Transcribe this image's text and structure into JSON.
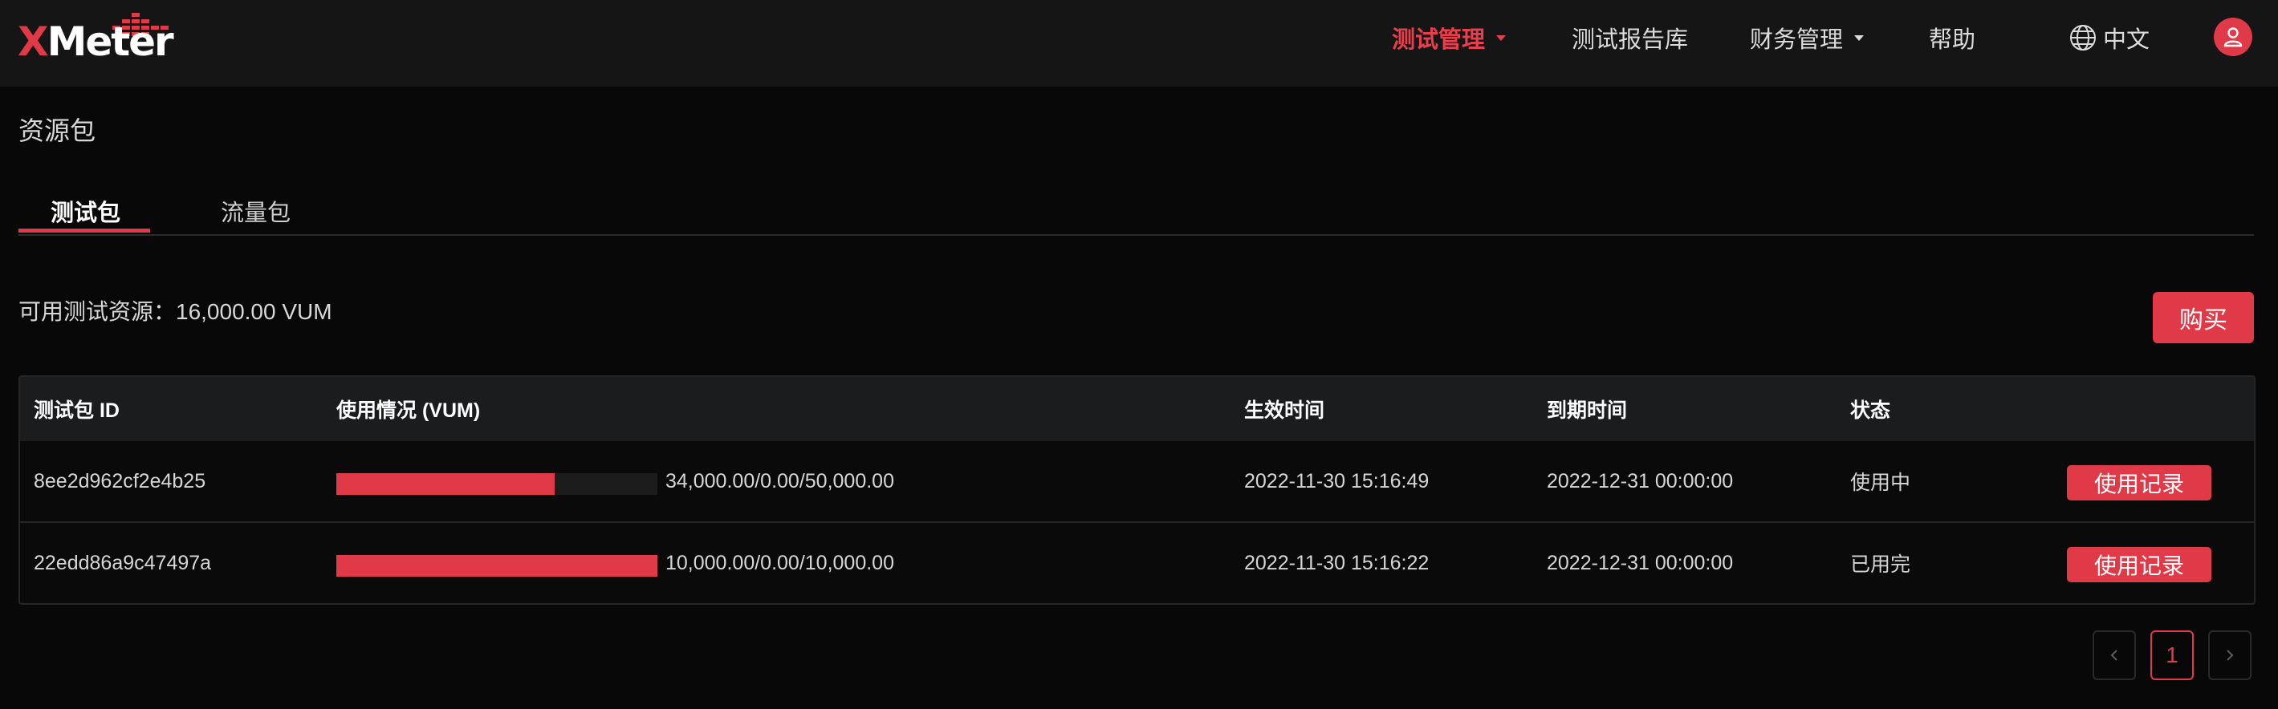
{
  "brand": {
    "logo_text": "XMeter",
    "accent": "#e03a48"
  },
  "nav": {
    "items": [
      {
        "label": "测试管理",
        "active": true,
        "dropdown": true
      },
      {
        "label": "测试报告库",
        "active": false,
        "dropdown": false
      },
      {
        "label": "财务管理",
        "active": false,
        "dropdown": true
      },
      {
        "label": "帮助",
        "active": false,
        "dropdown": false
      }
    ],
    "language": "中文",
    "icons": {
      "language": "globe-icon",
      "user": "user-icon"
    }
  },
  "page": {
    "title": "资源包",
    "tabs": [
      {
        "label": "测试包",
        "active": true
      },
      {
        "label": "流量包",
        "active": false
      }
    ],
    "available_resource": "可用测试资源：16,000.00 VUM",
    "buy_label": "购买"
  },
  "table": {
    "headers": [
      "测试包 ID",
      "使用情况 (VUM)",
      "生效时间",
      "到期时间",
      "状态"
    ],
    "rows": [
      {
        "id": "8ee2d962cf2e4b25",
        "usage_fraction": 0.68,
        "usage_text": "34,000.00/0.00/50,000.00",
        "start": "2022-11-30 15:16:49",
        "end": "2022-12-31 00:00:00",
        "status": "使用中",
        "action": "使用记录"
      },
      {
        "id": "22edd86a9c47497a",
        "usage_fraction": 1.0,
        "usage_text": "10,000.00/0.00/10,000.00",
        "start": "2022-11-30 15:16:22",
        "end": "2022-12-31 00:00:00",
        "status": "已用完",
        "action": "使用记录"
      }
    ]
  },
  "pagination": {
    "current": "1",
    "prev_icon": "chevron-left-icon",
    "next_icon": "chevron-right-icon"
  }
}
